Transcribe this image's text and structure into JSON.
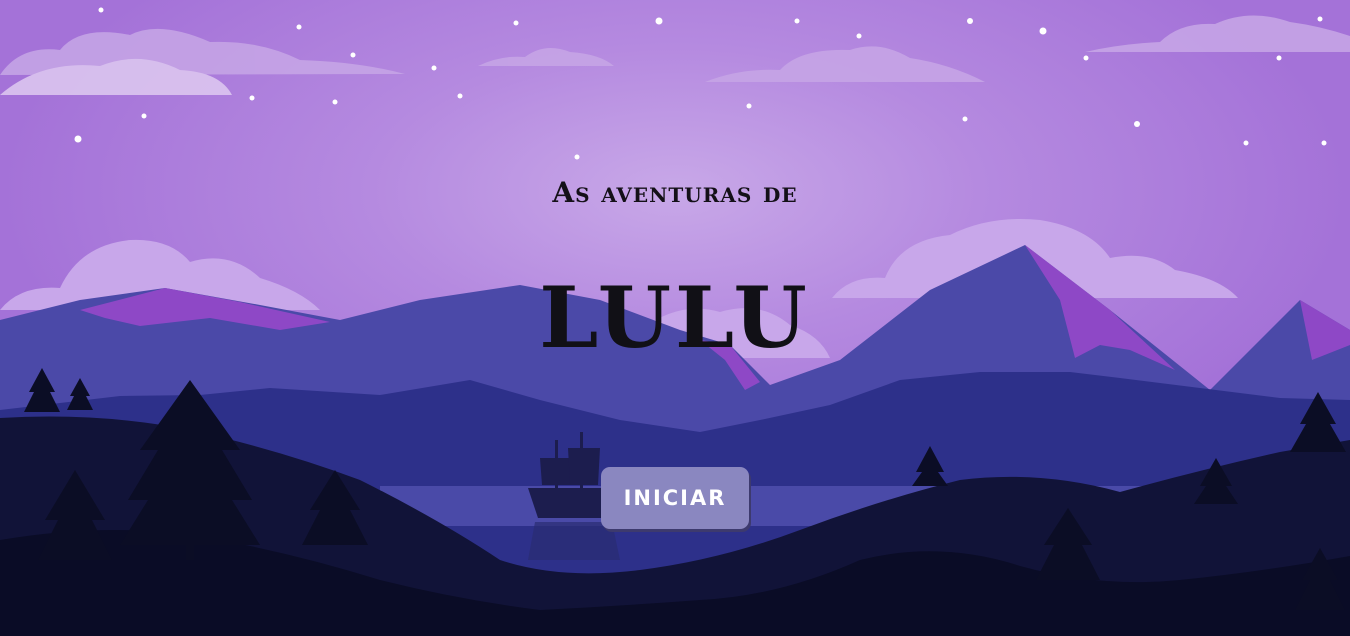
{
  "screen": {
    "subtitle": "As aventuras de",
    "title": "LULU",
    "start_button_label": "INICIAR"
  },
  "colors": {
    "sky": "#a878d8",
    "mountain_far": "#4b4aa8",
    "mountain_mid": "#2c2f86",
    "hills_dark": "#0c0f2e",
    "button": "#8a87c0"
  }
}
